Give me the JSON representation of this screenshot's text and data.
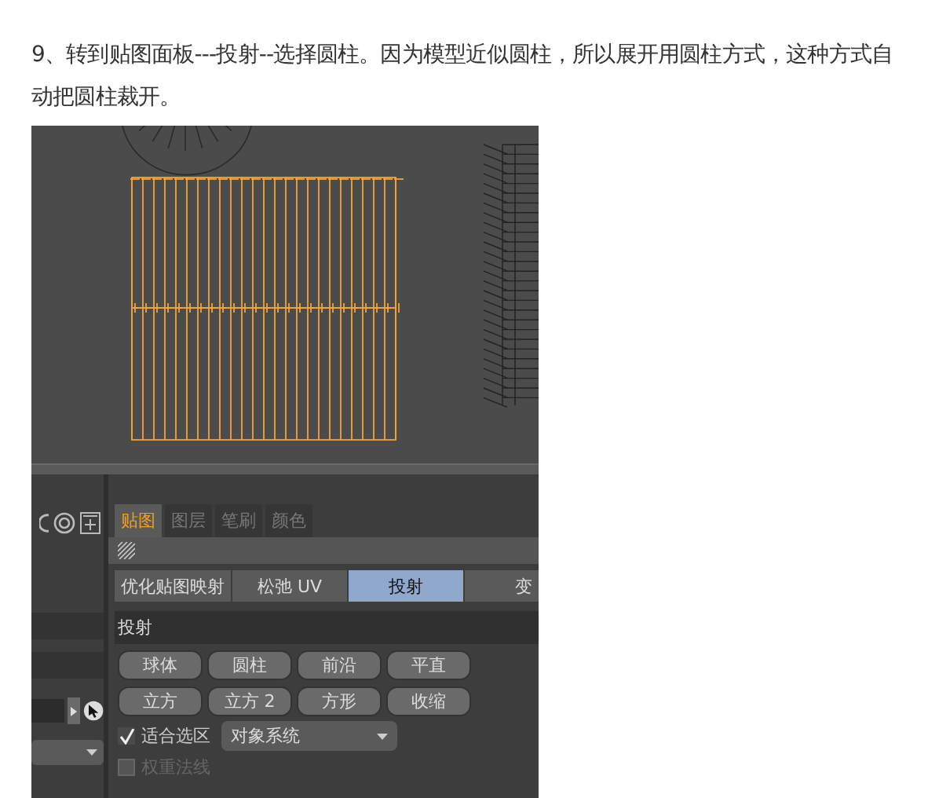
{
  "instruction": {
    "text": "9、转到贴图面板---投射--选择圆柱。因为模型近似圆柱，所以展开用圆柱方式，这种方式自动把圆柱裁开。"
  },
  "uv_panel": {
    "tabs": [
      {
        "label": "贴图",
        "selected": true
      },
      {
        "label": "图层",
        "selected": false
      },
      {
        "label": "笔刷",
        "selected": false
      },
      {
        "label": "颜色",
        "selected": false
      }
    ],
    "modes": [
      {
        "label": "优化贴图映射",
        "selected": false
      },
      {
        "label": "松弛 UV",
        "selected": false
      },
      {
        "label": "投射",
        "selected": true
      },
      {
        "label": "变",
        "selected": false
      }
    ],
    "section_title": "投射",
    "projections": [
      {
        "label": "球体"
      },
      {
        "label": "圆柱"
      },
      {
        "label": "前沿"
      },
      {
        "label": "平直"
      },
      {
        "label": "立方"
      },
      {
        "label": "立方 2"
      },
      {
        "label": "方形"
      },
      {
        "label": "收缩"
      }
    ],
    "options": [
      {
        "label": "适合选区",
        "checked": true,
        "disabled": false
      },
      {
        "label": "权重法线",
        "checked": false,
        "disabled": true
      }
    ],
    "system_dropdown": {
      "value": "对象系统"
    }
  }
}
